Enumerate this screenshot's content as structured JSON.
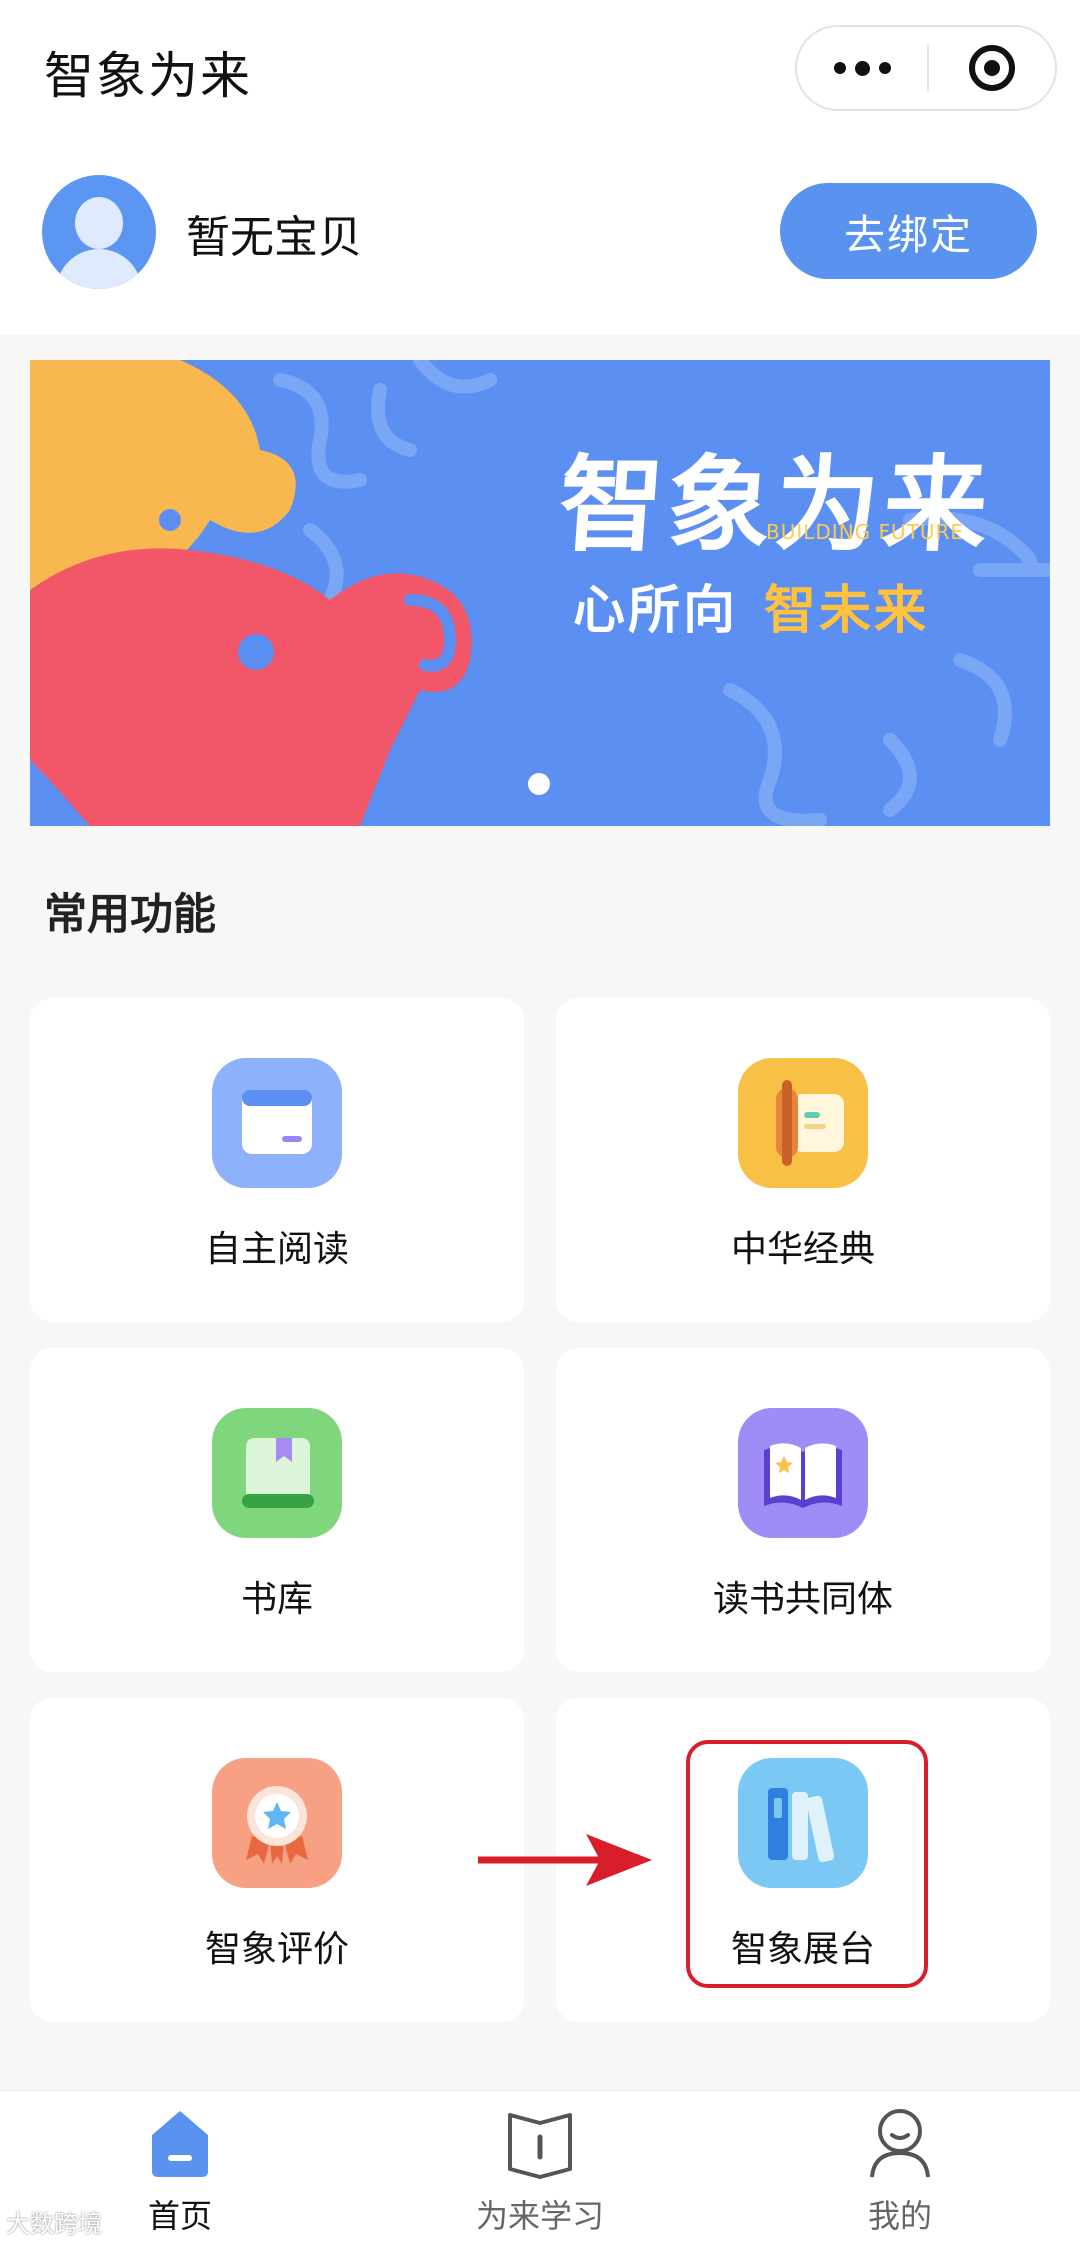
{
  "header": {
    "title": "智象为来",
    "capsule": {
      "more_icon": "more-dots-icon",
      "close_icon": "target-icon"
    }
  },
  "baby": {
    "name": "暂无宝贝",
    "bind_button": "去绑定"
  },
  "banner": {
    "title": "智象为来",
    "subtitle": "BUILDING FUTURE",
    "slogan_main": "心所向",
    "slogan_accent": "智未来",
    "colors": {
      "background": "#5b8ff1",
      "accent": "#ffc23f",
      "elephant_red": "#f25669",
      "elephant_yellow": "#f9b84f"
    }
  },
  "section": {
    "title": "常用功能"
  },
  "features": [
    {
      "label": "自主阅读",
      "icon": "browser-window-icon",
      "color": "#8db1fb"
    },
    {
      "label": "中华经典",
      "icon": "scroll-icon",
      "color": "#f9c046"
    },
    {
      "label": "书库",
      "icon": "book-icon",
      "color": "#7fd67d"
    },
    {
      "label": "读书共同体",
      "icon": "open-book-icon",
      "color": "#a08cf7"
    },
    {
      "label": "智象评价",
      "icon": "medal-icon",
      "color": "#f7a084"
    },
    {
      "label": "智象展台",
      "icon": "bookshelf-icon",
      "color": "#7cc8f4"
    }
  ],
  "tabbar": [
    {
      "label": "首页",
      "icon": "home-icon"
    },
    {
      "label": "为来学习",
      "icon": "book-outline-icon"
    },
    {
      "label": "我的",
      "icon": "user-icon"
    }
  ],
  "watermark": "大数跨境"
}
